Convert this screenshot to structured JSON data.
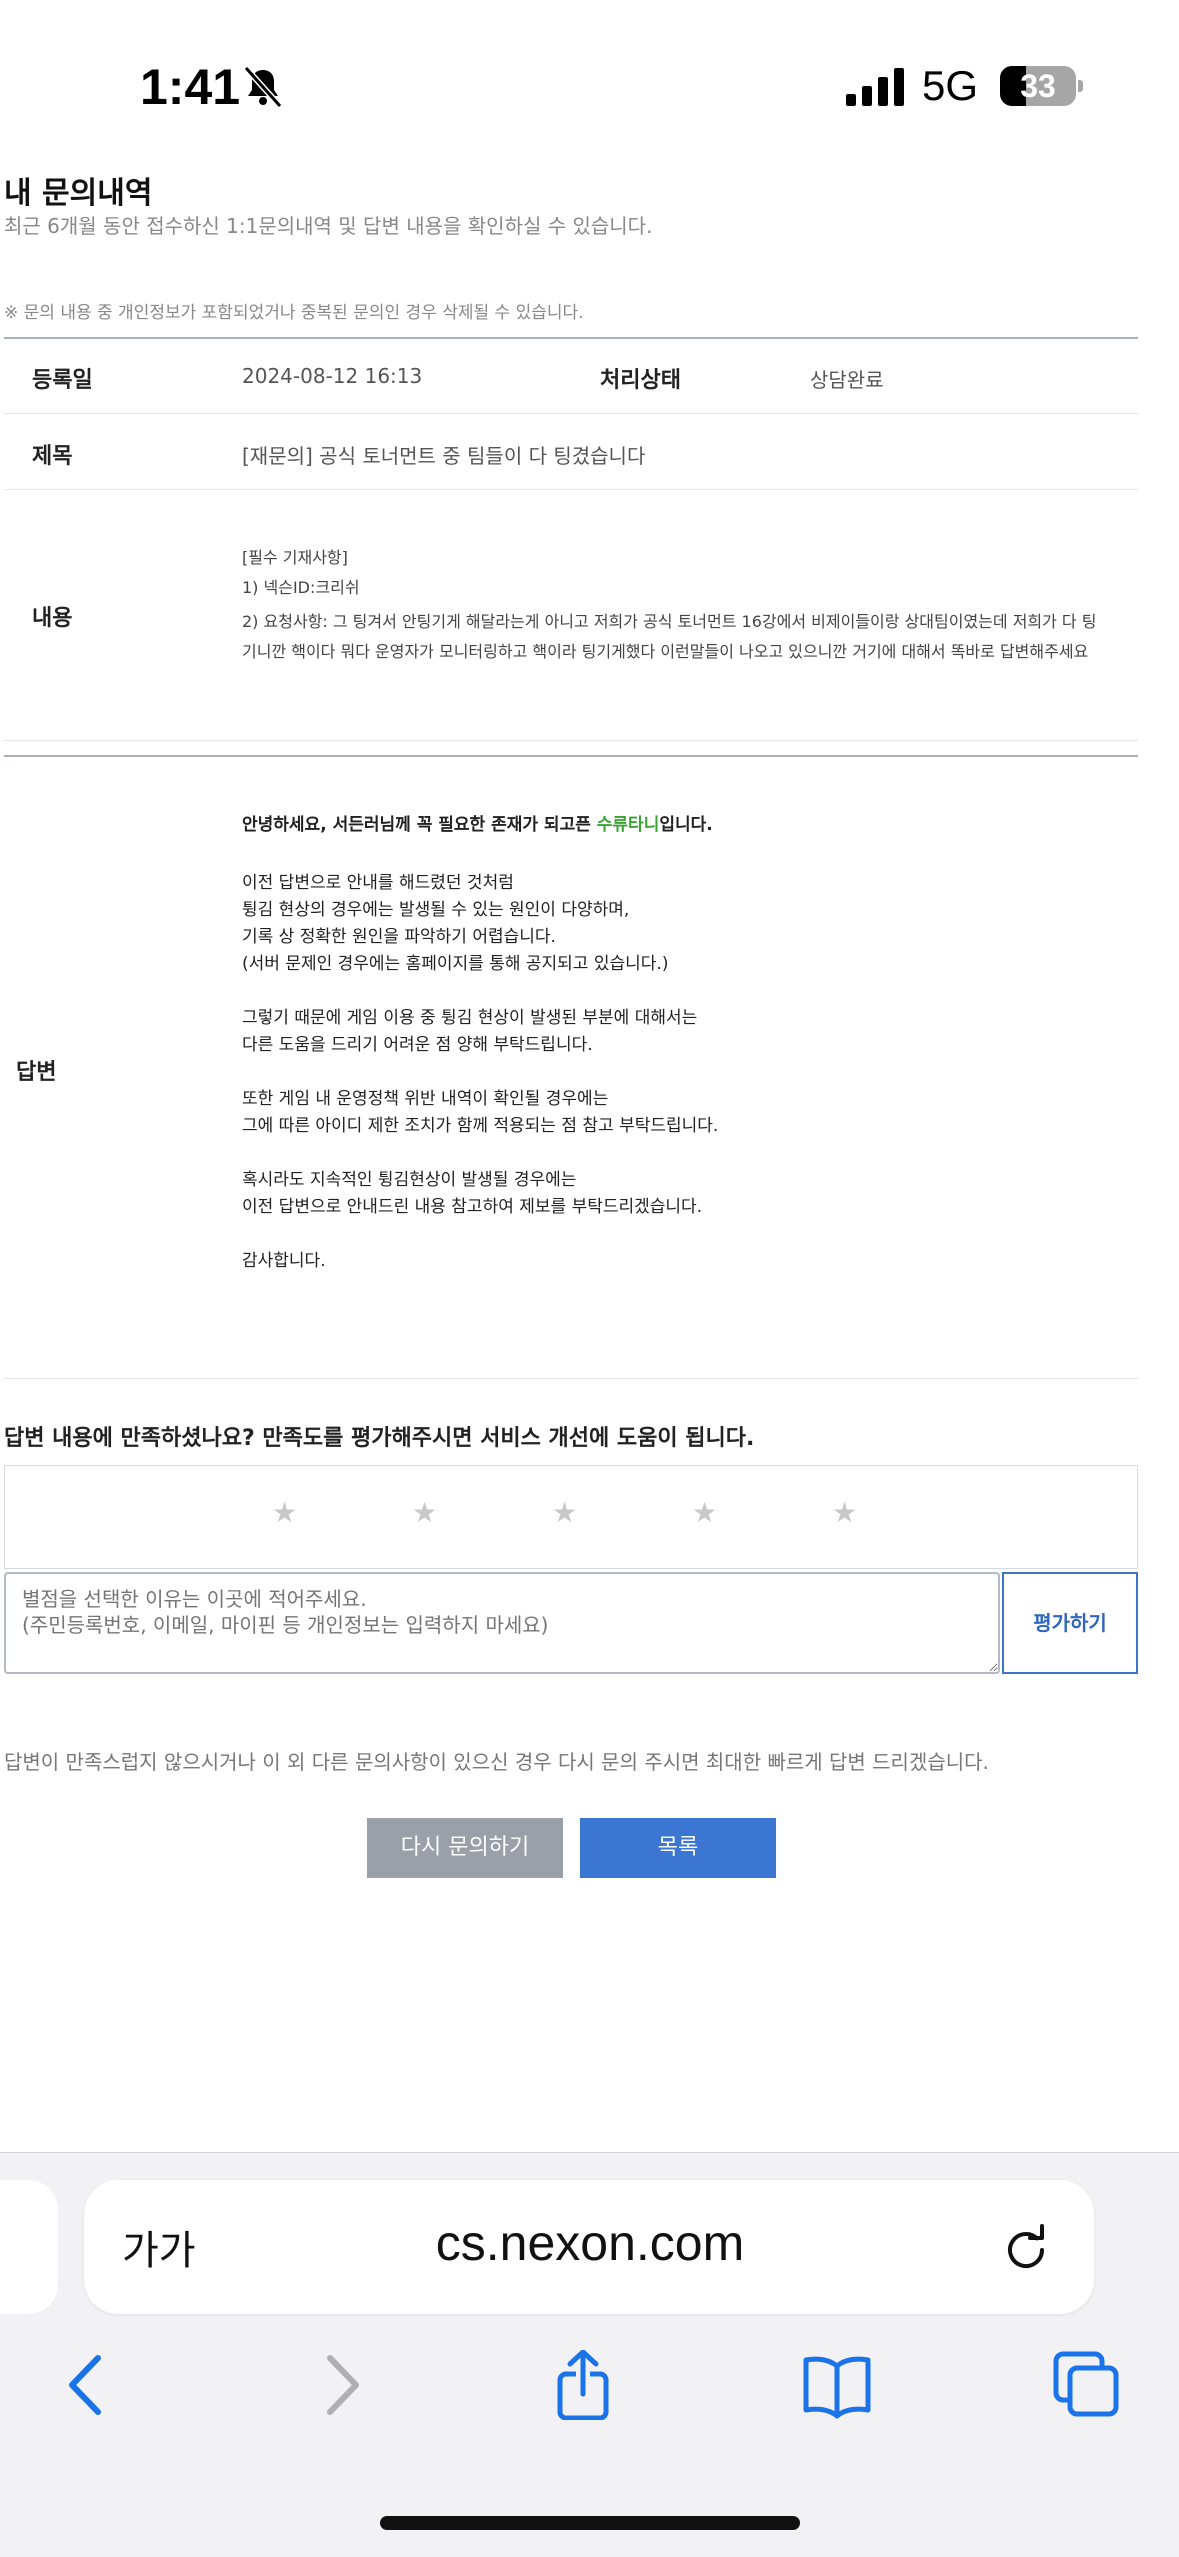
{
  "status_bar": {
    "time": "1:41",
    "network": "5G",
    "battery": "33"
  },
  "page": {
    "title": "내 문의내역",
    "subtitle": "최근 6개월 동안 접수하신 1:1문의내역 및 답변 내용을 확인하실 수 있습니다.",
    "notice": "※ 문의 내용 중 개인정보가 포함되었거나 중복된 문의인 경우 삭제될 수 있습니다."
  },
  "inquiry": {
    "date_label": "등록일",
    "date_value": "2024-08-12 16:13",
    "status_label": "처리상태",
    "status_value": "상담완료",
    "subject_label": "제목",
    "subject_value": "[재문의] 공식 토너먼트 중 팀들이 다 팅겼습니다",
    "content_label": "내용",
    "content_lines": [
      "[필수 기재사항]",
      "1) 넥슨ID:크리쉬",
      "2) 요청사항: 그 팅겨서 안팅기게 해달라는게 아니고 저희가 공식 토너먼트 16강에서 비제이들이랑 상대팀이였는데 저희가 다 팅",
      "기니깐 핵이다 뭐다 운영자가 모니터링하고 핵이라 팅기게했다 이런말들이 나오고 있으니깐 거기에 대해서 똑바로 답변해주세요"
    ]
  },
  "answer": {
    "label": "답변",
    "greeting_prefix": "안녕하세요, 서든러님께 꼭 필요한 존재가 되고픈 ",
    "greeting_highlight": "수류타니",
    "greeting_suffix": "입니다.",
    "lines": [
      "이전 답변으로 안내를 해드렸던 것처럼",
      "튕김 현상의 경우에는 발생될 수 있는 원인이 다양하며,",
      "기록 상 정확한 원인을 파악하기 어렵습니다.",
      "(서버 문제인 경우에는 홈페이지를 통해 공지되고 있습니다.)",
      "그렇기 때문에 게임 이용 중 튕김 현상이 발생된 부분에 대해서는",
      "다른 도움을 드리기 어려운 점 양해 부탁드립니다.",
      "또한 게임 내 운영정책 위반 내역이 확인될 경우에는",
      "그에 따른 아이디 제한 조치가 함께 적용되는 점 참고 부탁드립니다.",
      "혹시라도 지속적인 튕김현상이 발생될 경우에는",
      "이전 답변으로 안내드린 내용 참고하여 제보를 부탁드리겠습니다.",
      "감사합니다."
    ]
  },
  "rating": {
    "question": "답변 내용에 만족하셨나요? 만족도를 평가해주시면 서비스 개선에 도움이 됩니다.",
    "stars": [
      "★",
      "★",
      "★",
      "★",
      "★"
    ],
    "selected": 0,
    "placeholder": "별점을 선택한 이유는 이곳에 적어주세요.\n(주민등록번호, 이메일, 마이핀 등 개인정보는 입력하지 마세요)",
    "submit_label": "평가하기"
  },
  "footer": {
    "note": "답변이 만족스럽지 않으시거나 이 외 다른 문의사항이 있으신 경우 다시 문의 주시면 최대한 빠르게 답변 드리겠습니다.",
    "retry_label": "다시 문의하기",
    "list_label": "목록"
  },
  "browser": {
    "aa_label": "가가",
    "url": "cs.nexon.com",
    "accent_color": "#1a73e8"
  }
}
